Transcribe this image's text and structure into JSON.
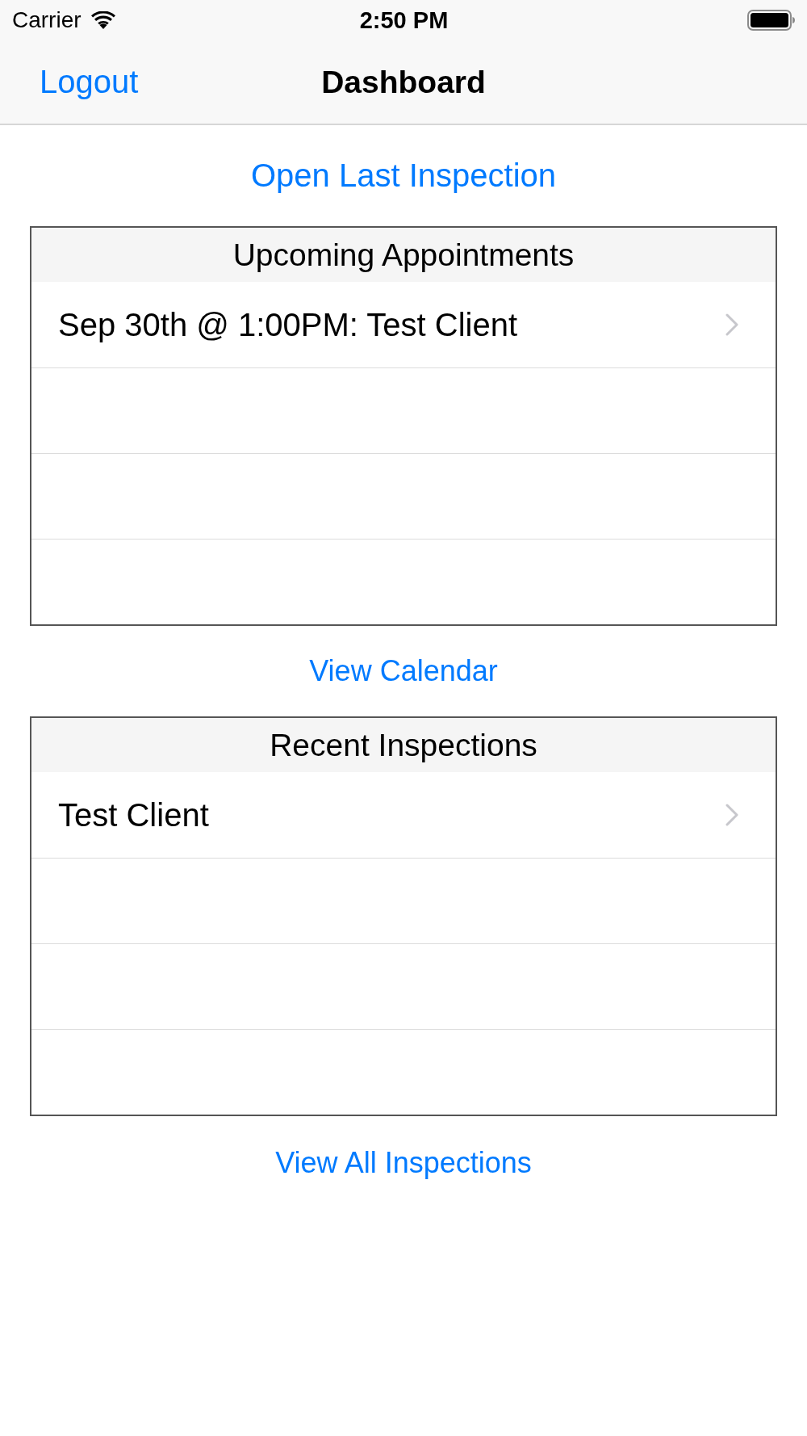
{
  "status_bar": {
    "carrier": "Carrier",
    "time": "2:50 PM"
  },
  "nav_bar": {
    "left_button": "Logout",
    "title": "Dashboard"
  },
  "open_last_inspection": "Open Last Inspection",
  "sections": [
    {
      "title": "Upcoming Appointments",
      "rows": [
        {
          "kind": "entry",
          "label": "Sep 30th @ 1:00PM: Test Client"
        },
        {
          "kind": "empty"
        },
        {
          "kind": "empty"
        },
        {
          "kind": "empty"
        }
      ],
      "footer_link": "View Calendar"
    },
    {
      "title": "Recent Inspections",
      "rows": [
        {
          "kind": "entry",
          "label": "Test Client"
        },
        {
          "kind": "empty"
        },
        {
          "kind": "empty"
        },
        {
          "kind": "empty"
        }
      ],
      "footer_link": "View All Inspections"
    }
  ]
}
